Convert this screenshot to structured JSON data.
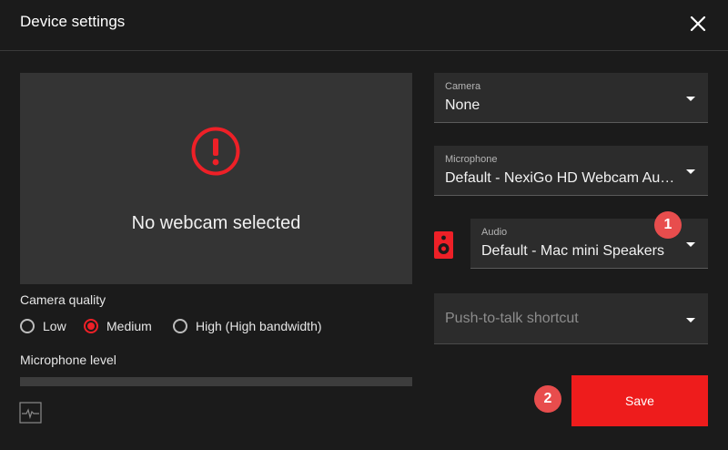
{
  "dialog": {
    "title": "Device settings"
  },
  "preview": {
    "message": "No webcam selected"
  },
  "camera_quality": {
    "label": "Camera quality",
    "options": [
      {
        "label": "Low",
        "checked": false
      },
      {
        "label": "Medium",
        "checked": true
      },
      {
        "label": "High (High bandwidth)",
        "checked": false
      }
    ]
  },
  "microphone_level": {
    "label": "Microphone level"
  },
  "camera_select": {
    "label": "Camera",
    "value": "None"
  },
  "microphone_select": {
    "label": "Microphone",
    "value": "Default - NexiGo HD Webcam Audio"
  },
  "audio_select": {
    "label": "Audio",
    "value": "Default - Mac mini Speakers"
  },
  "push_to_talk": {
    "placeholder": "Push-to-talk shortcut"
  },
  "badges": {
    "one": "1",
    "two": "2"
  },
  "save_button": {
    "label": "Save"
  },
  "colors": {
    "accent": "#ee1c1c",
    "background": "#1b1b1b",
    "panel": "#343434",
    "field": "#2c2c2c",
    "badge": "#e84d4d"
  },
  "icons": {
    "close": "close-icon",
    "warning": "warning-icon",
    "speaker": "speaker-icon",
    "pulse": "pulse-icon"
  }
}
